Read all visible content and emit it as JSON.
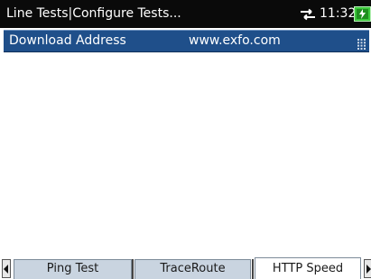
{
  "titlebar": {
    "title": "Line Tests|Configure Tests...",
    "time": "11:32",
    "network_icon": "network-arrows-icon",
    "battery_icon": "battery-charging-icon"
  },
  "header_row": {
    "label": "Download Address",
    "value": "www.exfo.com",
    "keypad_icon": "keypad-icon"
  },
  "tabs": [
    {
      "label": "Ping Test",
      "selected": false
    },
    {
      "label": "TraceRoute",
      "selected": false
    },
    {
      "label": "HTTP Speed",
      "selected": true
    }
  ],
  "colors": {
    "titlebar_bg": "#0a0a0a",
    "header_bg": "#1f4f8a",
    "tab_bg": "#c9d4e0",
    "battery_green": "#3cc83c"
  }
}
